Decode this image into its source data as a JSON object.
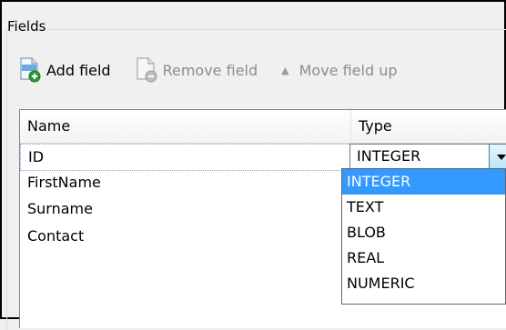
{
  "group": {
    "title": "Fields"
  },
  "toolbar": {
    "add_label": "Add field",
    "remove_label": "Remove field",
    "move_up_label": "Move field up",
    "add_icon": "add-document-icon",
    "remove_icon": "remove-document-icon",
    "move_up_icon": "arrow-up-icon"
  },
  "table": {
    "columns": {
      "name": "Name",
      "type": "Type"
    },
    "rows": [
      {
        "name": "ID",
        "type": "INTEGER"
      },
      {
        "name": "FirstName"
      },
      {
        "name": "Surname"
      },
      {
        "name": "Contact"
      }
    ]
  },
  "combo": {
    "value": "INTEGER",
    "options": [
      "INTEGER",
      "TEXT",
      "BLOB",
      "REAL",
      "NUMERIC"
    ],
    "selected_option": "INTEGER"
  },
  "colors": {
    "selection": "#3399ff",
    "header_bg": "#ffffff",
    "border": "#828790"
  }
}
